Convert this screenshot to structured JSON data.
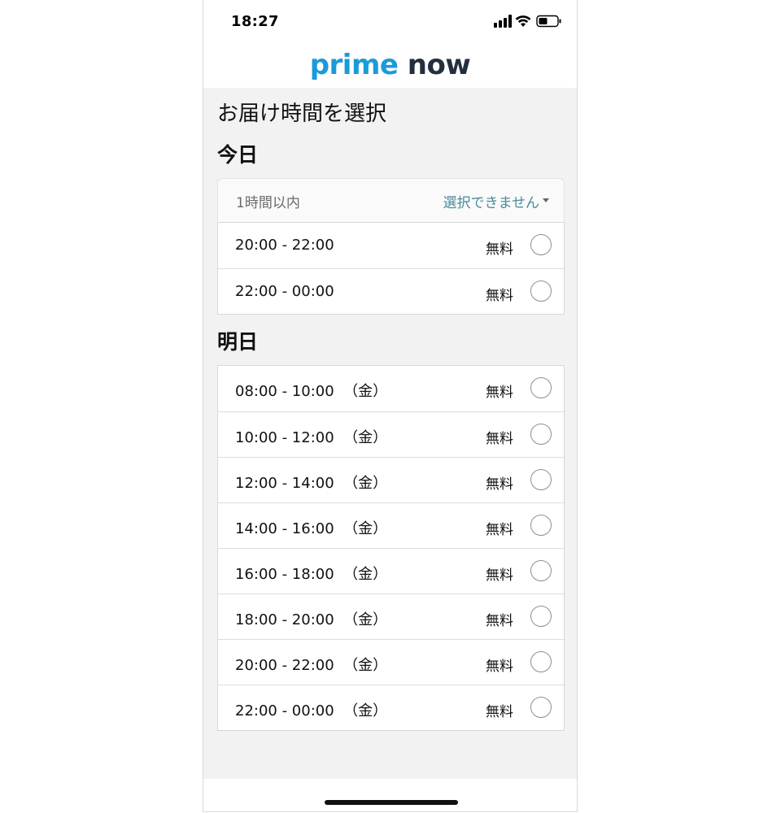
{
  "status_bar": {
    "time": "18:27"
  },
  "header": {
    "logo_prime": "prime",
    "logo_now": "now"
  },
  "colors": {
    "brand_blue": "#1a9bd7",
    "brand_dark": "#232f3e",
    "link_teal": "#4a8a9a",
    "background": "#f2f2f2"
  },
  "page": {
    "title": "お届け時間を選択"
  },
  "today": {
    "heading": "今日",
    "express": {
      "label": "1時間以内",
      "status": "選択できません"
    },
    "slots": [
      {
        "time": "20:00 - 22:00",
        "fee": "無料"
      },
      {
        "time": "22:00 - 00:00",
        "fee": "無料"
      }
    ]
  },
  "tomorrow": {
    "heading": "明日",
    "slots": [
      {
        "time": "08:00 - 10:00  （金）",
        "fee": "無料"
      },
      {
        "time": "10:00 - 12:00  （金）",
        "fee": "無料"
      },
      {
        "time": "12:00 - 14:00  （金）",
        "fee": "無料"
      },
      {
        "time": "14:00 - 16:00  （金）",
        "fee": "無料"
      },
      {
        "time": "16:00 - 18:00  （金）",
        "fee": "無料"
      },
      {
        "time": "18:00 - 20:00  （金）",
        "fee": "無料"
      },
      {
        "time": "20:00 - 22:00  （金）",
        "fee": "無料"
      },
      {
        "time": "22:00 - 00:00  （金）",
        "fee": "無料"
      }
    ]
  }
}
